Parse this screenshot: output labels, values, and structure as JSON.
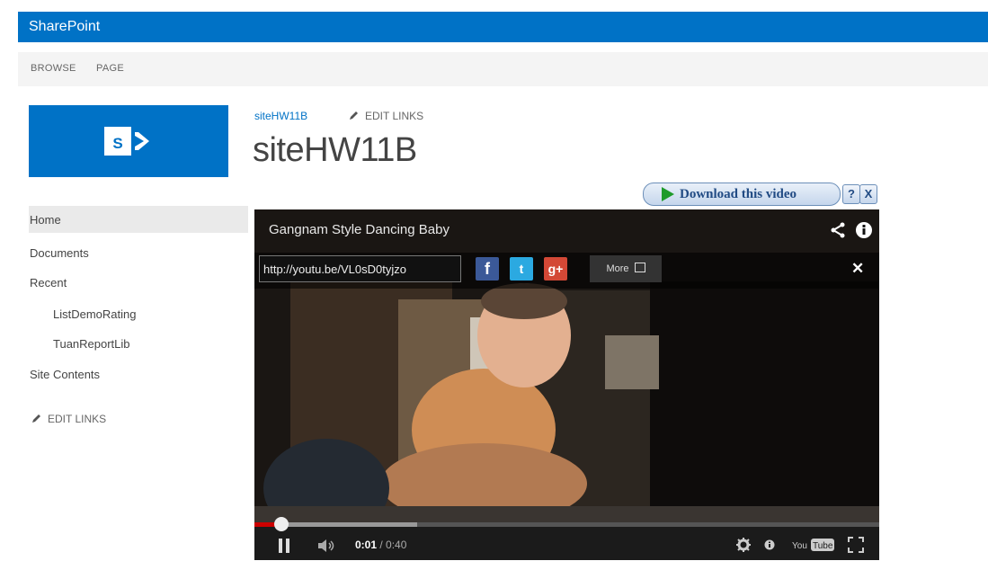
{
  "suite": {
    "brand": "SharePoint"
  },
  "ribbon": {
    "tabs": [
      "BROWSE",
      "PAGE"
    ]
  },
  "breadcrumb": {
    "site_link": "siteHW11B",
    "edit_links": "EDIT LINKS"
  },
  "page": {
    "title": "siteHW11B"
  },
  "quick_launch": {
    "items": [
      {
        "label": "Home",
        "indent": false,
        "selected": true
      },
      {
        "label": "Documents",
        "indent": false
      },
      {
        "label": "Recent",
        "indent": false
      },
      {
        "label": "ListDemoRating",
        "indent": true
      },
      {
        "label": "TuanReportLib",
        "indent": true
      },
      {
        "label": "Site Contents",
        "indent": false
      }
    ],
    "edit_links": "EDIT LINKS"
  },
  "download_bar": {
    "label": "Download this video",
    "help": "?",
    "close": "X"
  },
  "video": {
    "title": "Gangnam Style Dancing Baby",
    "share_url": "http://youtu.be/VL0sD0tyjzo",
    "social": [
      "f",
      "t",
      "g+"
    ],
    "more_label": "More",
    "close": "✕",
    "current_time": "0:01",
    "duration": "/ 0:40",
    "progress": 0.04,
    "buffered": 0.26
  },
  "colors": {
    "brand": "#0072c6",
    "played": "#cc0000"
  },
  "icons": [
    "sharepoint-logo",
    "pencil-icon",
    "share-icon",
    "info-icon",
    "pause-icon",
    "volume-icon",
    "settings-icon",
    "youtube-logo",
    "fullscreen-icon"
  ]
}
